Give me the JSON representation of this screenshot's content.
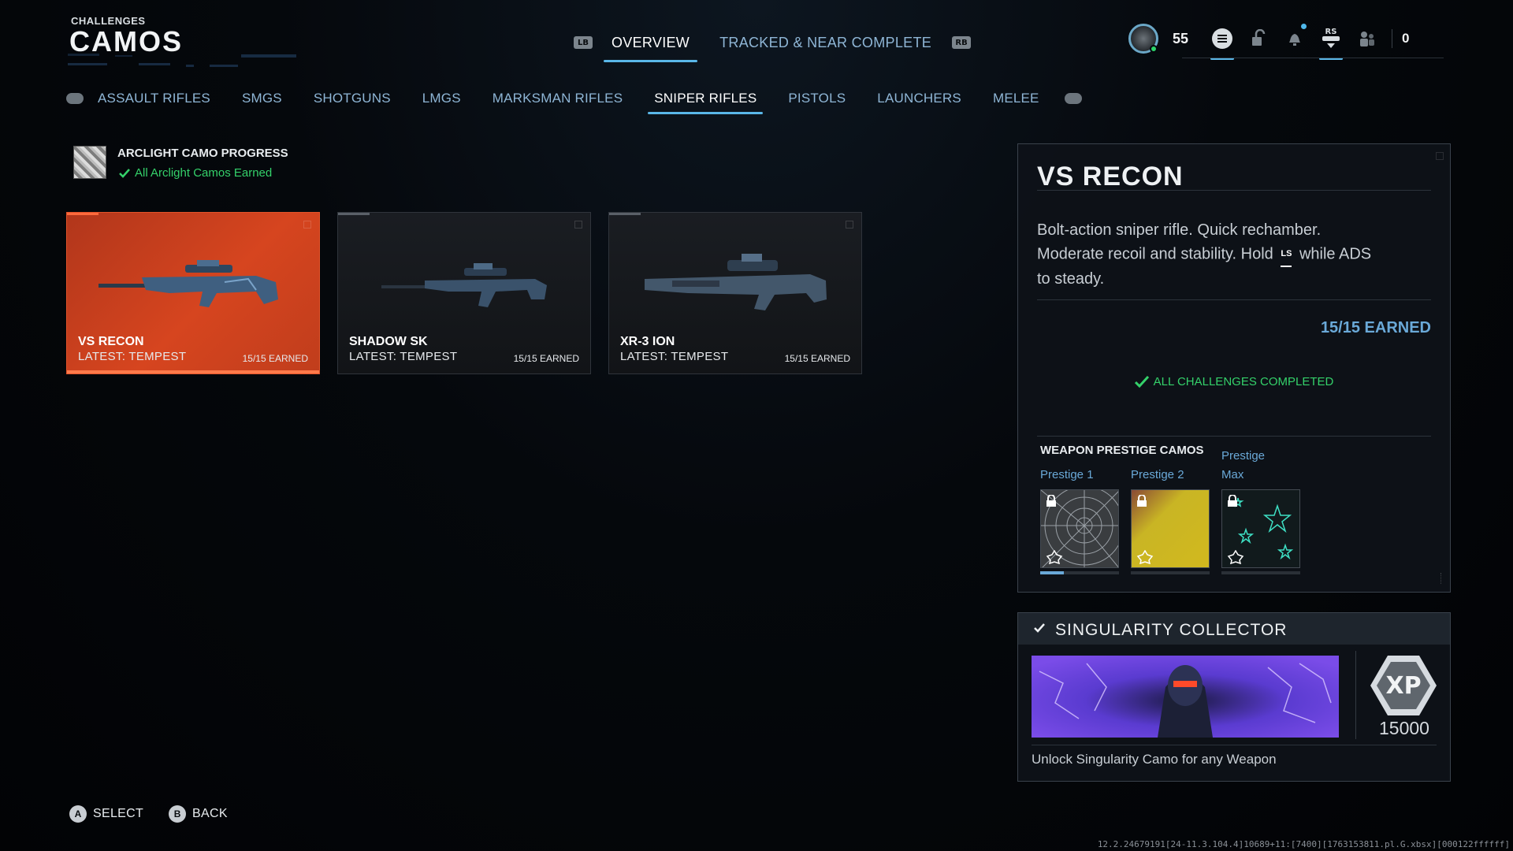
{
  "header": {
    "section": "CHALLENGES",
    "title": "CAMOS"
  },
  "top_nav": {
    "left_bumper": "LB",
    "right_bumper": "RB",
    "tabs": [
      {
        "label": "OVERVIEW",
        "active": true
      },
      {
        "label": "TRACKED & NEAR COMPLETE",
        "active": false
      }
    ]
  },
  "status_bar": {
    "level": "55",
    "rs_hint": "RS",
    "currency": "0",
    "icons": [
      "menu-icon",
      "lock-icon",
      "bell-icon",
      "rs-stick-icon",
      "friends-icon"
    ]
  },
  "categories": {
    "items": [
      "ASSAULT RIFLES",
      "SMGS",
      "SHOTGUNS",
      "LMGS",
      "MARKSMAN RIFLES",
      "SNIPER RIFLES",
      "PISTOLS",
      "LAUNCHERS",
      "MELEE"
    ],
    "active": "SNIPER RIFLES"
  },
  "arclight": {
    "title": "ARCLIGHT CAMO PROGRESS",
    "status": "All Arclight Camos Earned"
  },
  "weapons": [
    {
      "name": "VS RECON",
      "latest": "LATEST: TEMPEST",
      "earned": "15/15 EARNED",
      "selected": true
    },
    {
      "name": "SHADOW SK",
      "latest": "LATEST: TEMPEST",
      "earned": "15/15 EARNED",
      "selected": false
    },
    {
      "name": "XR-3 ION",
      "latest": "LATEST: TEMPEST",
      "earned": "15/15 EARNED",
      "selected": false
    }
  ],
  "detail": {
    "title": "VS RECON",
    "desc_line1": "Bolt-action sniper rifle.  Quick rechamber.",
    "desc_line2a": "Moderate recoil and stability.  Hold",
    "ls_hint": "LS",
    "desc_line2b": "while ADS",
    "desc_line3": "to steady.",
    "earned": "15/15 EARNED",
    "complete": "ALL CHALLENGES COMPLETED",
    "prestige_heading": "WEAPON PRESTIGE CAMOS",
    "prestige": [
      {
        "label": "Prestige 1",
        "progress": 0.3
      },
      {
        "label": "Prestige 2",
        "progress": 0
      },
      {
        "label_line1": "Prestige",
        "label_line2": "Max",
        "progress": 0
      }
    ]
  },
  "singularity": {
    "title": "SINGULARITY COLLECTOR",
    "xp_icon": "XP",
    "xp_value": "15000",
    "desc": "Unlock Singularity Camo for any Weapon"
  },
  "footer": {
    "select_glyph": "A",
    "select_label": "SELECT",
    "back_glyph": "B",
    "back_label": "BACK"
  },
  "build_string": "12.2.24679191[24-11.3.104.4]10689+11:[7400][1763153811.pl.G.xbsx][000122ffffff]",
  "colors": {
    "accent": "#5ab7e8",
    "selected_card": "#d6451f",
    "success": "#34d16a",
    "link": "#6aa9d8"
  }
}
